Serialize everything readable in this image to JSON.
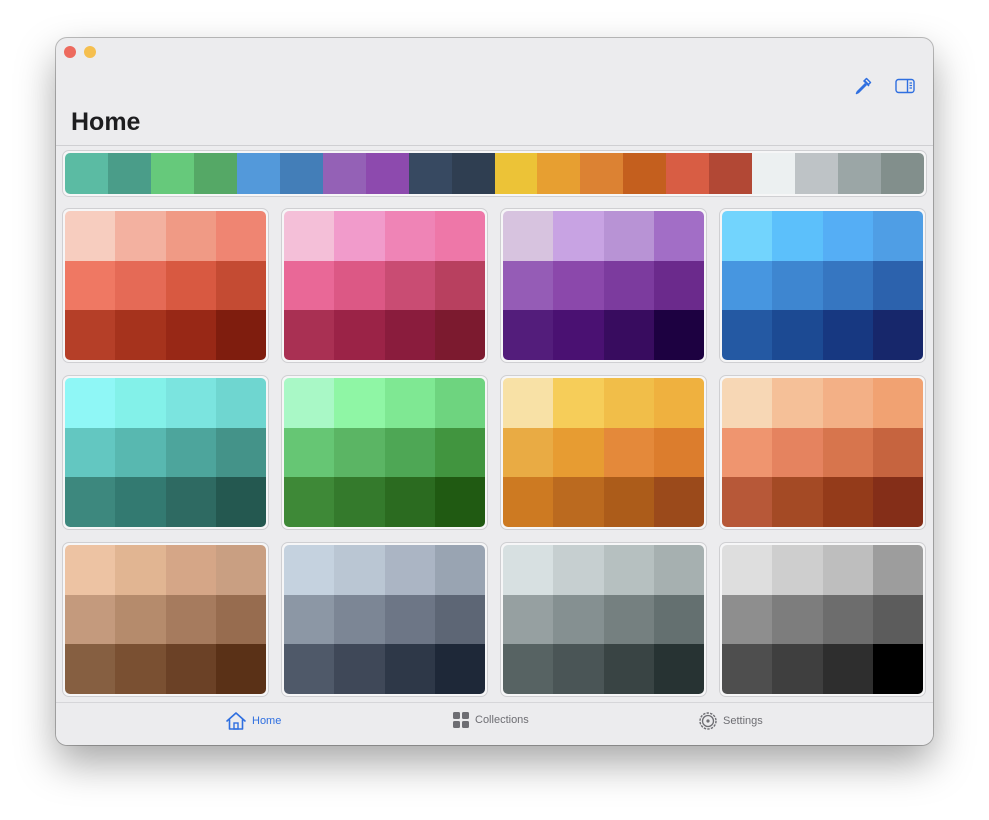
{
  "window": {
    "title": "Home",
    "traffic_lights": [
      {
        "name": "close",
        "color": "#ed6a5e"
      },
      {
        "name": "minimize",
        "color": "#f5bf4f"
      }
    ]
  },
  "toolbar": {
    "icons": [
      "eyedropper-icon",
      "sidebar-icon"
    ],
    "accent": "#2f6fe0"
  },
  "strip": {
    "colors": [
      "#5bbba3",
      "#4a9d89",
      "#66c97b",
      "#55a866",
      "#5399da",
      "#437eb8",
      "#9461b6",
      "#8d4aae",
      "#374961",
      "#2f3e51",
      "#ecc337",
      "#e79f31",
      "#dc8233",
      "#c45f1e",
      "#d85d44",
      "#b24835",
      "#ecf0f1",
      "#bec3c6",
      "#9ba6a6",
      "#828f8c"
    ]
  },
  "palettes": [
    {
      "name": "red",
      "colors": [
        "#f7cdbf",
        "#f3b1a0",
        "#f09a85",
        "#ef8572",
        "#ef7863",
        "#e56a56",
        "#d85941",
        "#c44b33",
        "#b53f28",
        "#a6331d",
        "#982816",
        "#7f1d0e"
      ]
    },
    {
      "name": "pink",
      "colors": [
        "#f4bfd8",
        "#f19bcb",
        "#ef84b6",
        "#ee77a8",
        "#e96897",
        "#dc5885",
        "#c94c73",
        "#b8405f",
        "#a93053",
        "#9b2347",
        "#8a1c3d",
        "#7c1a2f"
      ]
    },
    {
      "name": "purple",
      "colors": [
        "#d7c3df",
        "#c8a3e3",
        "#b893d5",
        "#a26ec6",
        "#955cb6",
        "#8b48ab",
        "#7c3b9e",
        "#6b2a8c",
        "#531d7b",
        "#4a1172",
        "#380c5f",
        "#1d0141"
      ]
    },
    {
      "name": "blue",
      "colors": [
        "#72d4fd",
        "#5cc0fb",
        "#55aef5",
        "#4f9ee5",
        "#4796e0",
        "#3e86d0",
        "#3676c1",
        "#2c62ad",
        "#2459a3",
        "#1c4a93",
        "#173881",
        "#17276b"
      ]
    },
    {
      "name": "teal",
      "colors": [
        "#8ff7f6",
        "#83f1e9",
        "#7be4df",
        "#6fd6d0",
        "#63c7c1",
        "#58b8b0",
        "#4da59c",
        "#449389",
        "#3d887e",
        "#337a71",
        "#2e6a62",
        "#245850"
      ]
    },
    {
      "name": "green",
      "colors": [
        "#a9f8c6",
        "#8ff6a5",
        "#7fe893",
        "#6ed47f",
        "#66c674",
        "#5bb564",
        "#4ea755",
        "#41953f",
        "#3e8937",
        "#347a2c",
        "#2b6b20",
        "#205a12"
      ]
    },
    {
      "name": "yellow",
      "colors": [
        "#f8e1a6",
        "#f6cd59",
        "#f1be49",
        "#efb13f",
        "#e9ab44",
        "#e79c32",
        "#e4893a",
        "#dc7d2d",
        "#cd7a22",
        "#bb6a1f",
        "#ac5c1a",
        "#9b4a1b"
      ]
    },
    {
      "name": "orange",
      "colors": [
        "#f7d7b5",
        "#f5c098",
        "#f3b086",
        "#f1a272",
        "#ef956f",
        "#e5835f",
        "#d7754d",
        "#c6643f",
        "#b75838",
        "#a44a25",
        "#943b1a",
        "#842e18"
      ]
    },
    {
      "name": "brown",
      "colors": [
        "#edc3a3",
        "#e1b592",
        "#d5a687",
        "#c99f82",
        "#c49a7d",
        "#b58b6c",
        "#a67b5e",
        "#976c4f",
        "#865f41",
        "#7a5032",
        "#6b4126",
        "#5a3117"
      ]
    },
    {
      "name": "slate",
      "colors": [
        "#c5d2df",
        "#bac6d3",
        "#abb5c4",
        "#99a4b2",
        "#8c97a5",
        "#7c8695",
        "#6d7686",
        "#5d6675",
        "#4f5969",
        "#3f4858",
        "#2e3848",
        "#1e2838"
      ]
    },
    {
      "name": "gray",
      "colors": [
        "#d7e0e1",
        "#c6cfd0",
        "#b6c0c0",
        "#a6b0b0",
        "#96a0a1",
        "#859091",
        "#758080",
        "#647070",
        "#576363",
        "#4a5556",
        "#394444",
        "#273333"
      ]
    },
    {
      "name": "neutral",
      "colors": [
        "#dedede",
        "#cecece",
        "#bebebe",
        "#9d9d9d",
        "#8e8e8e",
        "#7d7d7d",
        "#6d6d6d",
        "#5c5c5c",
        "#4e4e4e",
        "#3f3f3f",
        "#2e2e2e",
        "#000000"
      ]
    }
  ],
  "tabbar": {
    "tabs": [
      {
        "label": "Home",
        "icon": "house-icon",
        "active": true
      },
      {
        "label": "Collections",
        "icon": "grid-icon",
        "active": false
      },
      {
        "label": "Settings",
        "icon": "gear-icon",
        "active": false
      }
    ]
  }
}
